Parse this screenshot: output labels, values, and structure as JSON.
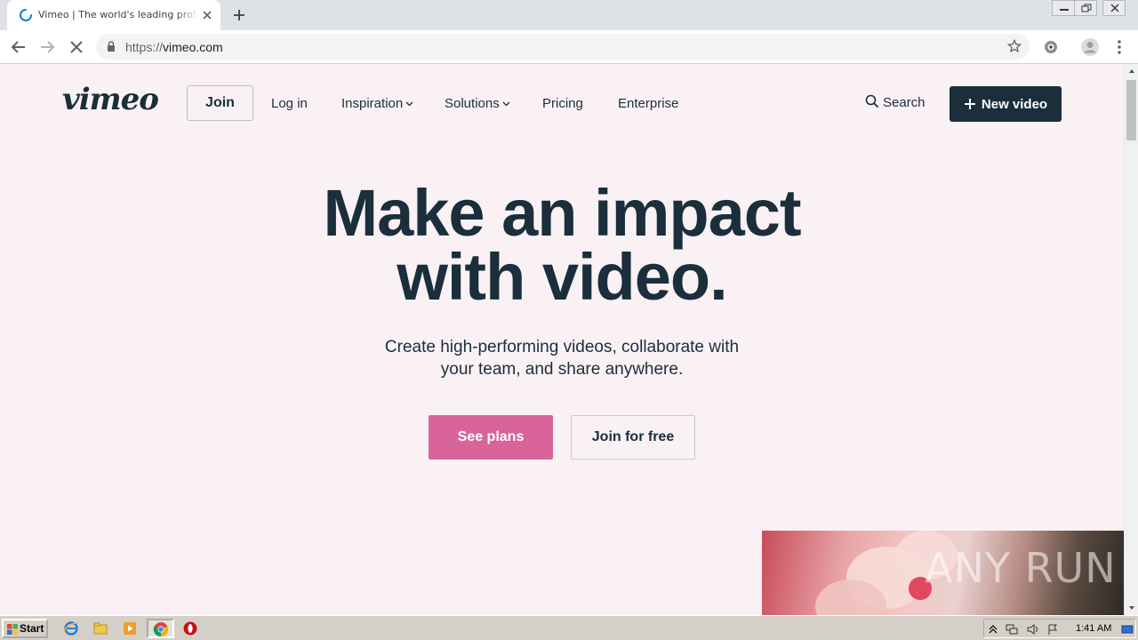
{
  "browser": {
    "tab_title": "Vimeo | The world's leading professional video platform",
    "url_scheme": "https://",
    "url_host": "vimeo.com"
  },
  "site": {
    "logo": "vimeo",
    "nav": {
      "join": "Join",
      "login": "Log in",
      "inspiration": "Inspiration",
      "solutions": "Solutions",
      "pricing": "Pricing",
      "enterprise": "Enterprise",
      "search": "Search",
      "new_video": "New video"
    },
    "hero": {
      "title_line1": "Make an impact",
      "title_line2": "with video.",
      "subtitle_line1": "Create high-performing videos, collaborate with",
      "subtitle_line2": "your team, and share anywhere.",
      "primary_cta": "See plans",
      "secondary_cta": "Join for free"
    },
    "watermark": "ANY RUN"
  },
  "taskbar": {
    "start": "Start",
    "clock": "1:41 AM"
  },
  "colors": {
    "page_bg": "#faf1f4",
    "brand_dark": "#1a2e3b",
    "accent_pink": "#d9649b"
  }
}
